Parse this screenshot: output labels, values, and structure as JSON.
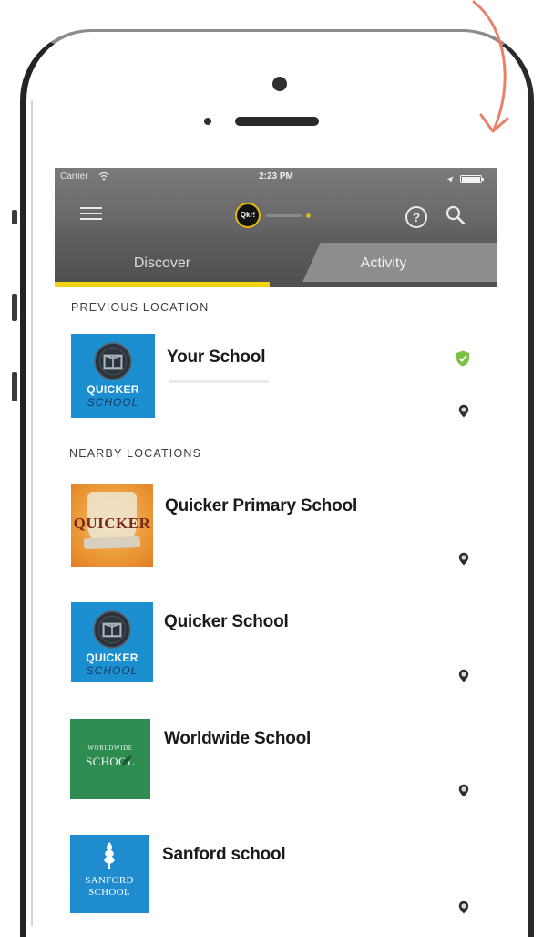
{
  "status_bar": {
    "carrier": "Carrier",
    "time": "2:23 PM"
  },
  "header": {
    "logo_text": "Qkr!"
  },
  "tabs": [
    {
      "label": "Discover",
      "active": true
    },
    {
      "label": "Activity",
      "active": false
    }
  ],
  "previous_location": {
    "heading": "PREVIOUS LOCATION",
    "items": [
      {
        "name": "Your School",
        "verified": true,
        "logo": {
          "lines": [
            "QUICKER",
            "SCHOOL"
          ],
          "bg": "#1b8fd0"
        }
      }
    ]
  },
  "nearby_locations": {
    "heading": "NEARBY LOCATIONS",
    "items": [
      {
        "name": "Quicker Primary School",
        "logo": {
          "lines": [
            "QUICKER"
          ],
          "bg": "#ec9c3c"
        }
      },
      {
        "name": "Quicker School",
        "logo": {
          "lines": [
            "QUICKER",
            "SCHOOL"
          ],
          "bg": "#1b8fd0"
        }
      },
      {
        "name": "Worldwide School",
        "logo": {
          "lines": [
            "WORLDWIDE",
            "SCHOOL"
          ],
          "bg": "#2f8c50"
        }
      },
      {
        "name": "Sanford school",
        "logo": {
          "lines": [
            "SANFORD",
            "SCHOOL"
          ],
          "bg": "#1f8cd0"
        }
      }
    ]
  },
  "icons": {
    "menu": "hamburger-icon",
    "help": "help-icon",
    "search": "search-icon",
    "verified": "shield-check-icon",
    "location": "location-pin-icon",
    "wifi": "wifi-icon",
    "battery": "battery-icon"
  },
  "colors": {
    "tab_indicator": "#f2d30f",
    "header_bg": "#5c5c5c",
    "verified": "#7cc242",
    "annotation_arrow": "#e8806a",
    "logo_ring": "#e2b80e"
  }
}
